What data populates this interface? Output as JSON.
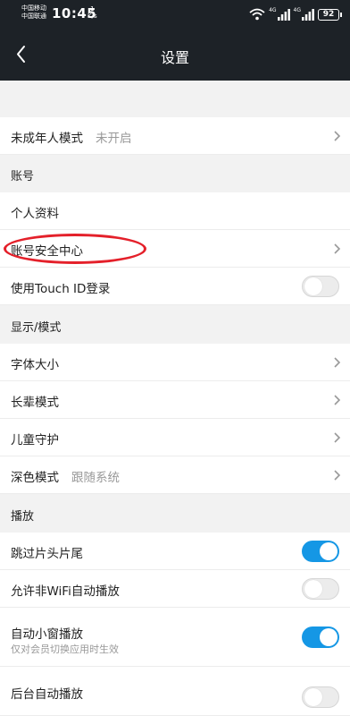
{
  "status_bar": {
    "carrier_1": "中国移动",
    "carrier_2": "中国联通",
    "time": "10:45",
    "net_speed_value": "1",
    "net_speed_unit": "K/s",
    "signal_1_tag": "4G",
    "signal_2_tag": "4G",
    "battery": "92"
  },
  "header": {
    "title": "设置"
  },
  "rows": {
    "minor_mode": {
      "label": "未成年人模式",
      "value": "未开启"
    },
    "profile": {
      "label": "个人资料"
    },
    "security_center": {
      "label": "账号安全中心"
    },
    "touch_id": {
      "label": "使用Touch ID登录",
      "toggle": false
    },
    "font_size": {
      "label": "字体大小"
    },
    "elder_mode": {
      "label": "长辈模式"
    },
    "kid_guard": {
      "label": "儿童守护"
    },
    "dark_mode": {
      "label": "深色模式",
      "value": "跟随系统"
    },
    "skip_intro": {
      "label": "跳过片头片尾",
      "toggle": true
    },
    "non_wifi_autoplay": {
      "label": "允许非WiFi自动播放",
      "toggle": false
    },
    "mini_window": {
      "label": "自动小窗播放",
      "sub": "仅对会员切换应用时生效",
      "toggle": true
    },
    "background_play": {
      "label": "后台自动播放",
      "toggle": false
    }
  },
  "sections": {
    "account": "账号",
    "display": "显示/模式",
    "playback": "播放"
  },
  "colors": {
    "navbar_bg": "#1d2227",
    "toggle_on": "#1597e5",
    "annotation": "#e4202a",
    "page_bg": "#f2f2f2"
  }
}
